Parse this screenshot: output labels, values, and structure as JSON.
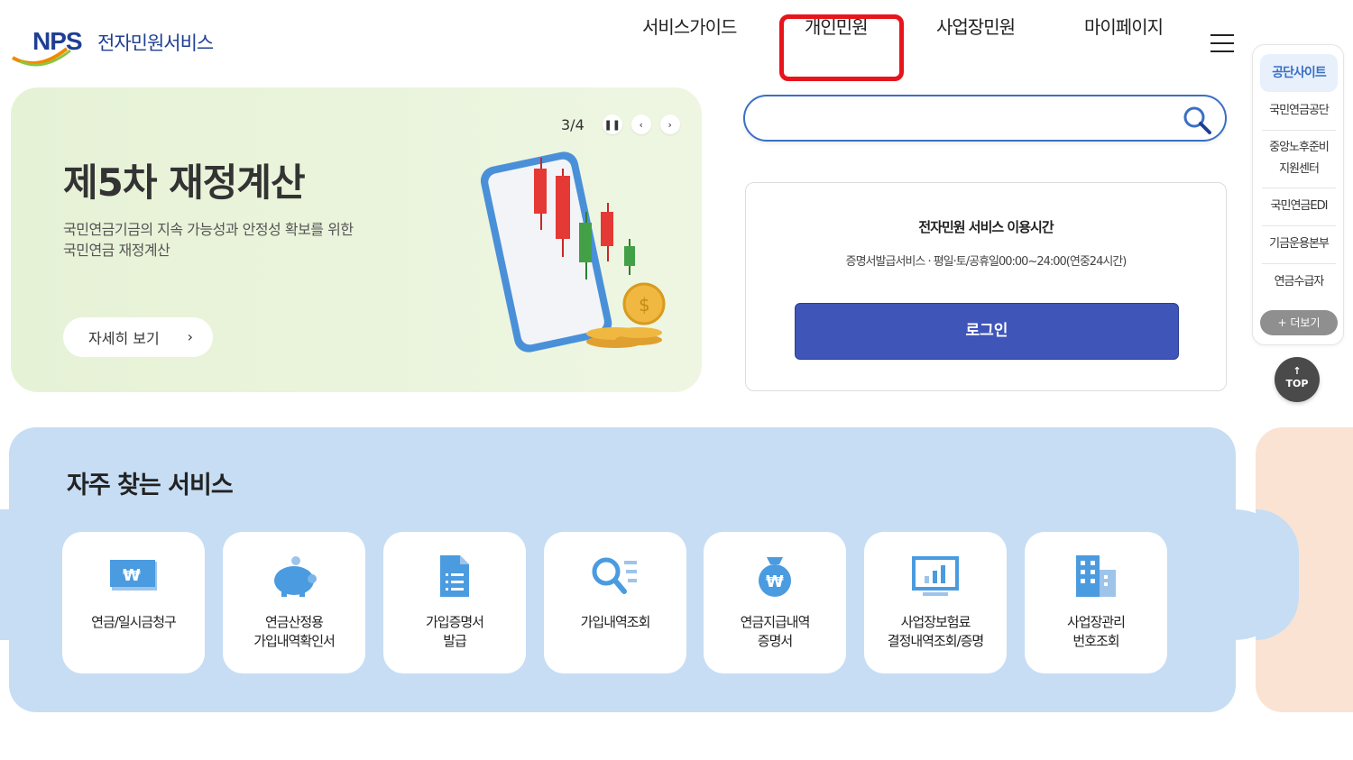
{
  "header": {
    "logo_nps": "NPS",
    "logo_text": "전자민원서비스",
    "nav": [
      "서비스가이드",
      "개인민원",
      "사업장민원",
      "마이페이지"
    ]
  },
  "banner": {
    "pager": "3/4",
    "title": "제5차 재정계산",
    "desc_line1": "국민연금기금의 지속 가능성과 안정성 확보를 위한",
    "desc_line2": "국민연금 재정계산",
    "more_label": "자세히 보기"
  },
  "search": {
    "placeholder": "",
    "value": ""
  },
  "login": {
    "title": "전자민원 서비스 이용시간",
    "hours": "증명서발급서비스 · 평일·토/공휴일00:00~24:00(연중24시간)",
    "button": "로그인"
  },
  "side": {
    "head": "공단사이트",
    "items": [
      "국민연금공단",
      "중앙노후준비\n지원센터",
      "국민연금EDI",
      "기금운용본부",
      "연금수급자"
    ],
    "more": "+ 더보기",
    "top": "TOP"
  },
  "freq": {
    "title": "자주 찾는 서비스",
    "items": [
      "연금/일시금청구",
      "연금산정용\n가입내역확인서",
      "가입증명서\n발급",
      "가입내역조회",
      "연금지급내역\n증명서",
      "사업장보험료\n결정내역조회/증명",
      "사업장관리\n번호조회"
    ]
  },
  "colors": {
    "brand": "#1f3f93",
    "accent": "#3a6fc4",
    "login_btn": "#3f55b8",
    "highlight": "#e8141c"
  },
  "icons": [
    "search-icon",
    "hamburger-icon",
    "pause-icon",
    "chevron-left-icon",
    "chevron-right-icon",
    "won-card-icon",
    "piggy-bank-icon",
    "document-icon",
    "search-list-icon",
    "money-bag-icon",
    "monitor-chart-icon",
    "building-icon"
  ]
}
